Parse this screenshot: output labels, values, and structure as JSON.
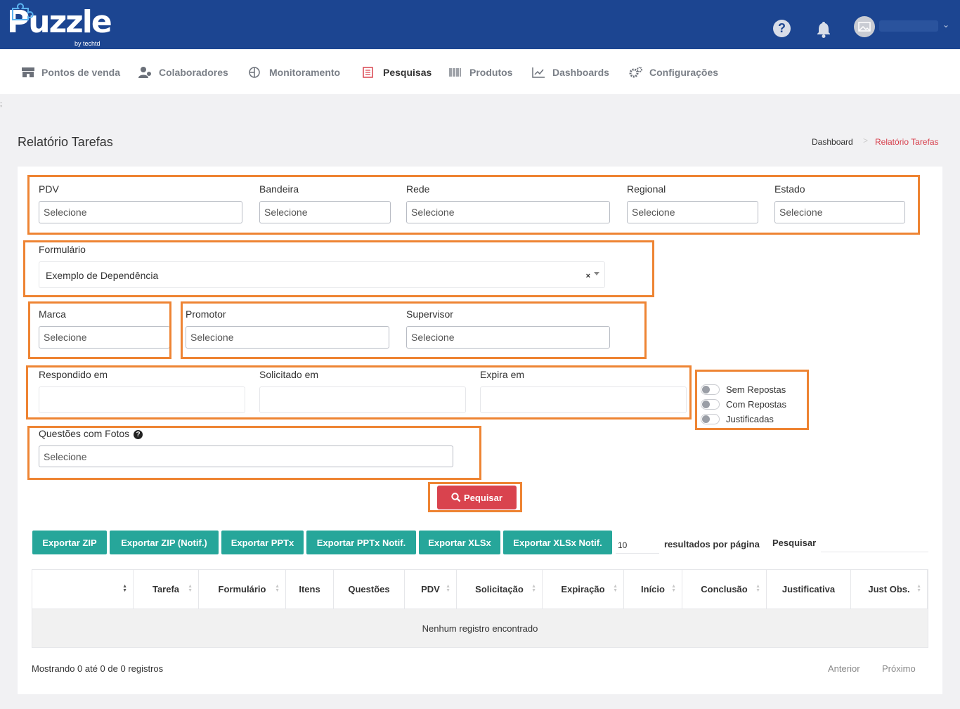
{
  "brand": {
    "logo_text": "Puzzle",
    "logo_sub": "by techtd"
  },
  "header": {
    "help_label": "?",
    "user_name": "",
    "chevron": "⌄"
  },
  "menu": [
    {
      "label": "Pontos de venda",
      "icon": "store-icon"
    },
    {
      "label": "Colaboradores",
      "icon": "users-icon"
    },
    {
      "label": "Monitoramento",
      "icon": "monitor-icon"
    },
    {
      "label": "Pesquisas",
      "icon": "survey-icon",
      "active": true
    },
    {
      "label": "Produtos",
      "icon": "barcode-icon"
    },
    {
      "label": "Dashboards",
      "icon": "chart-line-icon"
    },
    {
      "label": "Configurações",
      "icon": "gears-icon"
    }
  ],
  "stray_char": ";",
  "page": {
    "title": "Relatório Tarefas"
  },
  "breadcrumb": {
    "home": "Dashboard",
    "separator": ">",
    "current": "Relatório Tarefas"
  },
  "filters": {
    "pdv": {
      "label": "PDV",
      "value": "Selecione"
    },
    "bandeira": {
      "label": "Bandeira",
      "value": "Selecione"
    },
    "rede": {
      "label": "Rede",
      "value": "Selecione"
    },
    "regional": {
      "label": "Regional",
      "value": "Selecione"
    },
    "estado": {
      "label": "Estado",
      "value": "Selecione"
    },
    "formulario": {
      "label": "Formulário",
      "value": "Exemplo de Dependência",
      "clear": "×"
    },
    "marca": {
      "label": "Marca",
      "value": "Selecione"
    },
    "promotor": {
      "label": "Promotor",
      "value": "Selecione"
    },
    "supervisor": {
      "label": "Supervisor",
      "value": "Selecione"
    },
    "respondido": {
      "label": "Respondido em",
      "value": ""
    },
    "solicitado": {
      "label": "Solicitado em",
      "value": ""
    },
    "expira": {
      "label": "Expira em",
      "value": ""
    },
    "questoes_fotos": {
      "label": "Questões com Fotos",
      "help": "?",
      "value": "Selecione"
    }
  },
  "toggles": [
    {
      "label": "Sem Repostas",
      "on": false
    },
    {
      "label": "Com Repostas",
      "on": false
    },
    {
      "label": "Justificadas",
      "on": false
    }
  ],
  "search_button": {
    "label": "Pequisar"
  },
  "export_buttons": [
    {
      "label": "Exportar ZIP"
    },
    {
      "label": "Exportar ZIP (Notif.)"
    },
    {
      "label": "Exportar PPTx"
    },
    {
      "label": "Exportar PPTx Notif."
    },
    {
      "label": "Exportar XLSx"
    },
    {
      "label": "Exportar XLSx Notif."
    }
  ],
  "table_controls": {
    "per_page_value": "10",
    "per_page_label": "resultados por página",
    "search_label": "Pesquisar",
    "search_value": ""
  },
  "table": {
    "columns": [
      "",
      "Tarefa",
      "Formulário",
      "Itens",
      "Questões",
      "PDV",
      "Solicitação",
      "Expiração",
      "Início",
      "Conclusão",
      "Justificativa",
      "Just Obs."
    ],
    "empty_message": "Nenhum registro encontrado"
  },
  "footer": {
    "showing": "Mostrando 0 até 0 de 0 registros",
    "prev": "Anterior",
    "next": "Próximo"
  },
  "colors": {
    "topbar": "#1c4591",
    "accent_red": "#d9434e",
    "export_teal": "#26a69a",
    "highlight": "#ee8433"
  }
}
